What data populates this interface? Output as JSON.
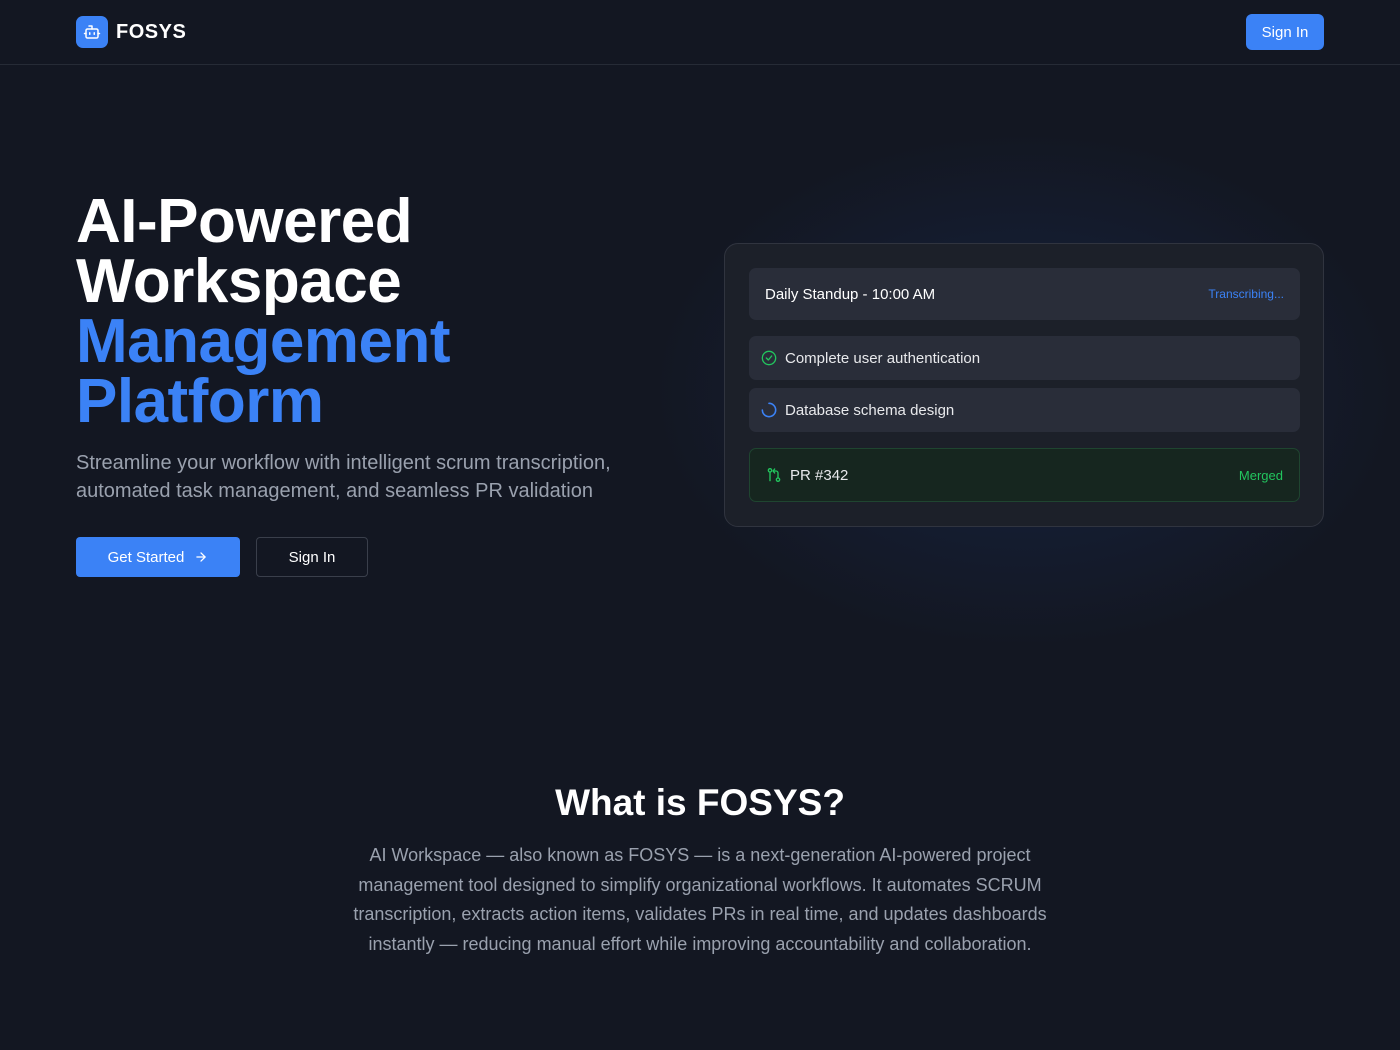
{
  "header": {
    "brand": "FOSYS",
    "signin_label": "Sign In",
    "logo_icon": "bot-icon"
  },
  "hero": {
    "title_line1": "AI-Powered",
    "title_line2": "Workspace",
    "title_line3": "Management",
    "title_line4": "Platform",
    "subtitle": "Streamline your workflow with intelligent scrum transcription, automated task management, and seamless PR validation",
    "get_started_label": "Get Started",
    "signin_label": "Sign In"
  },
  "preview_card": {
    "standup": {
      "title": "Daily Standup - 10:00 AM",
      "status": "Transcribing..."
    },
    "tasks": [
      {
        "label": "Complete user authentication",
        "icon": "check-circle-icon"
      },
      {
        "label": "Database schema design",
        "icon": "spinner-icon"
      }
    ],
    "pr": {
      "label": "PR #342",
      "status": "Merged",
      "icon": "git-pull-request-icon"
    }
  },
  "about": {
    "title": "What is FOSYS?",
    "text": "AI Workspace — also known as FOSYS — is a next-generation AI-powered project management tool designed to simplify organizational workflows. It automates SCRUM transcription, extracts action items, validates PRs in real time, and updates dashboards instantly — reducing manual effort while improving accountability and collaboration."
  },
  "colors": {
    "background": "#131722",
    "accent": "#3b82f6",
    "success": "#22c55e",
    "muted_text": "#9aa1ae"
  }
}
